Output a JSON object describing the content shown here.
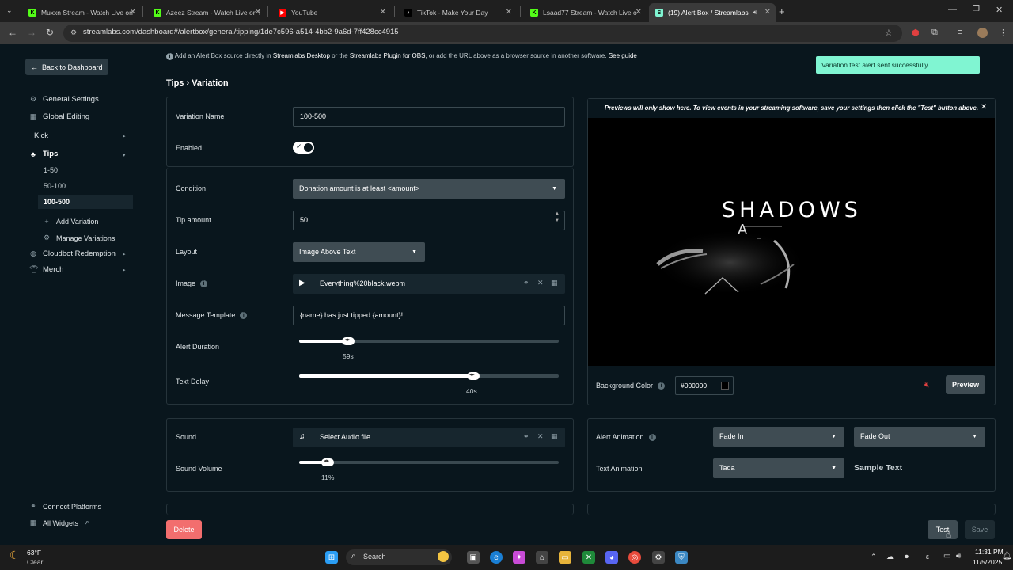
{
  "browser": {
    "tabs": [
      {
        "title": "Muxxn Stream - Watch Live on",
        "favicon": "kick-icon",
        "color": "#53fc18"
      },
      {
        "title": "Azeez Stream - Watch Live on I",
        "favicon": "kick-icon",
        "color": "#53fc18"
      },
      {
        "title": "YouTube",
        "favicon": "youtube-icon",
        "color": "#ff0000"
      },
      {
        "title": "TikTok - Make Your Day",
        "favicon": "tiktok-icon",
        "color": "#ffffff"
      },
      {
        "title": "Lsaad77 Stream - Watch Live o",
        "favicon": "kick-icon",
        "color": "#53fc18"
      },
      {
        "title": "(19) Alert Box / Streamlabs",
        "favicon": "streamlabs-icon",
        "color": "#80f5d2"
      }
    ],
    "url": "streamlabs.com/dashboard#/alertbox/general/tipping/1de7c596-a514-4bb2-9a6d-7ff428cc4915"
  },
  "sidebar": {
    "back_label": "Back to Dashboard",
    "items": [
      {
        "label": "General Settings",
        "icon": "gear-icon"
      },
      {
        "label": "Global Editing",
        "icon": "grid-icon"
      },
      {
        "label": "Kick",
        "icon": ""
      },
      {
        "label": "Tips",
        "icon": "tip-icon"
      },
      {
        "label": "Add Variation",
        "icon": "plus-icon"
      },
      {
        "label": "Manage Variations",
        "icon": "gear-icon"
      },
      {
        "label": "Cloudbot Redemption",
        "icon": "cloudbot-icon"
      },
      {
        "label": "Merch",
        "icon": "shirt-icon"
      }
    ],
    "variations": [
      "1-50",
      "50-100",
      "100-500"
    ],
    "bottom": [
      {
        "label": "Connect Platforms",
        "icon": "link-icon"
      },
      {
        "label": "All Widgets",
        "icon": "grid-icon"
      }
    ]
  },
  "notice": {
    "pre": "Add an Alert Box source directly in",
    "link1": "Streamlabs Desktop",
    "mid": "or the",
    "link2": "Streamlabs Plugin for OBS",
    "post": ", or add the URL above as a browser source in another software.",
    "link3": "See guide"
  },
  "toast": "Variation test alert sent successfully",
  "breadcrumb": "Tips › Variation",
  "form": {
    "variation_name_label": "Variation Name",
    "variation_name_value": "100-500",
    "enabled_label": "Enabled",
    "enabled": true,
    "condition_label": "Condition",
    "condition_value": "Donation amount is at least <amount>",
    "tip_amount_label": "Tip amount",
    "tip_amount_value": "50",
    "layout_label": "Layout",
    "layout_value": "Image Above Text",
    "image_label": "Image",
    "image_file": "Everything%20black.webm",
    "message_template_label": "Message Template",
    "message_template_value": "{name} has just tipped {amount}!",
    "alert_duration_label": "Alert Duration",
    "alert_duration_value": "59s",
    "alert_duration_fraction": 0.19,
    "text_delay_label": "Text Delay",
    "text_delay_value": "40s",
    "text_delay_fraction": 0.67
  },
  "sound": {
    "sound_label": "Sound",
    "sound_file": "Select Audio file",
    "volume_label": "Sound Volume",
    "volume_value": "11%",
    "volume_fraction": 0.11
  },
  "preview": {
    "note": "Previews will only show here. To view events in your streaming software, save your settings then click the \"Test\" button above.",
    "title_text": "SHADOWS",
    "sub_text": "A",
    "background_label": "Background Color",
    "background_value": "#000000",
    "preview_button": "Preview"
  },
  "animation": {
    "alert_label": "Alert Animation",
    "alert_in": "Fade In",
    "alert_out": "Fade Out",
    "text_label": "Text Animation",
    "text_value": "Tada",
    "sample": "Sample Text"
  },
  "footer": {
    "delete": "Delete",
    "test": "Test",
    "save": "Save"
  },
  "taskbar": {
    "weather_temp": "63°F",
    "weather_desc": "Clear",
    "search": "Search",
    "time": "11:31 PM",
    "date": "11/5/2025"
  },
  "colors": {
    "accent": "#80f5d2",
    "danger": "#f26e6e",
    "background": "#09161d"
  }
}
